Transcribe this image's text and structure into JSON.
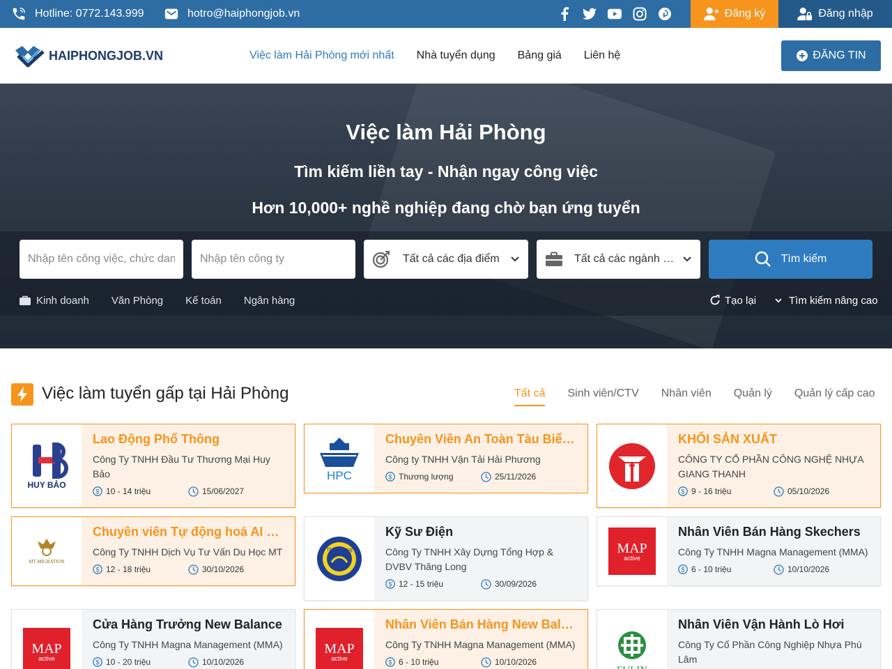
{
  "topbar": {
    "hotline": "Hotline: 0772.143.999",
    "email": "hotro@haiphongjob.vn",
    "register": "Đăng ký",
    "login": "Đăng nhập"
  },
  "header": {
    "logo_text": "HAIPHONGJOB.VN",
    "nav": [
      "Việc làm Hải Phòng mới nhất",
      "Nhà tuyển dụng",
      "Bảng giá",
      "Liên hệ"
    ],
    "post_button": "ĐĂNG TIN"
  },
  "hero": {
    "title": "Việc làm Hải Phòng",
    "subtitle1": "Tìm kiếm liền tay - Nhận ngay công việc",
    "subtitle2": "Hơn 10,000+ nghề nghiệp đang chờ bạn ứng tuyển",
    "job_placeholder": "Nhập tên công việc, chức danh",
    "company_placeholder": "Nhập tên công ty",
    "location": "Tất cả các địa điểm",
    "industry": "Tất cả các ngành nghề",
    "search_button": "Tìm kiếm",
    "tags": [
      "Kinh doanh",
      "Văn Phòng",
      "Kế toán",
      "Ngân hàng"
    ],
    "reset": "Tạo lại",
    "advanced": "Tìm kiếm nâng cao"
  },
  "section": {
    "title": "Việc làm tuyển gấp tại Hải Phòng",
    "filters": [
      "Tất cả",
      "Sinh viên/CTV",
      "Nhân viên",
      "Quản lý",
      "Quản lý cấp cao"
    ]
  },
  "jobs": [
    {
      "title": "Lao Động Phổ Thông",
      "company": "Công Ty TNHH Đầu Tư Thương Mại Huy Bảo",
      "salary": "10 - 14 triệu",
      "date": "15/06/2027",
      "logo": "HUY BẢO"
    },
    {
      "title": "Chuyên Viên An Toàn Tàu Biển (DPA/CSO)",
      "company": "Công ty TNHH Vận Tải Hải Phương",
      "salary": "Thương lượng",
      "date": "25/11/2026",
      "logo": "HPC"
    },
    {
      "title": "KHỐI SẢN XUẤT",
      "company": "CÔNG TY CỔ PHẦN CÔNG NGHỆ NHỰA GIANG THANH",
      "salary": "9 - 16 triệu",
      "date": "05/10/2026",
      "logo": "GT"
    },
    {
      "title": "Chuyên viên Tự động hoá AI phát triển",
      "company": "Công Ty TNHH Dịch Vụ Tư Vấn Du Học MT",
      "salary": "12 - 18 triệu",
      "date": "30/10/2026",
      "logo": "MT MIGRATION"
    },
    {
      "title": "Kỹ Sư Điện",
      "company": "Công Ty TNHH Xây Dựng Tổng Hợp & DVBV Thăng Long",
      "salary": "12 - 15 triệu",
      "date": "30/09/2026",
      "logo": "Thăng Long"
    },
    {
      "title": "Nhân Viên Bán Hàng Skechers",
      "company": "Công Ty TNHH Magna Management (MMA)",
      "salary": "6 - 10 triệu",
      "date": "10/10/2026",
      "logo": "MAP active"
    },
    {
      "title": "Cửa Hàng Trưởng New Balance",
      "company": "Công Ty TNHH Magna Management (MMA)",
      "salary": "10 - 20 triệu",
      "date": "10/10/2026",
      "logo": "MAP active"
    },
    {
      "title": "Nhân Viên Bán Hàng New Balance",
      "company": "Công Ty TNHH Magna Management (MMA)",
      "salary": "6 - 10 triệu",
      "date": "10/10/2026",
      "logo": "MAP active"
    },
    {
      "title": "Nhân Viên Vận Hành Lò Hơi",
      "company": "Công Ty Cổ Phần Công Nghiệp Nhựa Phú Lâm",
      "salary": "",
      "date": "",
      "logo": "FULIN"
    }
  ]
}
